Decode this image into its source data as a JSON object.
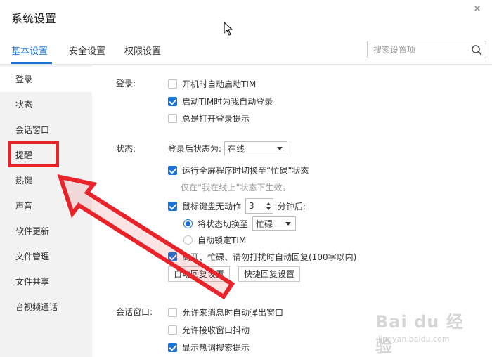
{
  "window": {
    "title": "系统设置",
    "close_glyph": "✕"
  },
  "tabs": [
    {
      "label": "基本设置",
      "active": true
    },
    {
      "label": "安全设置",
      "active": false
    },
    {
      "label": "权限设置",
      "active": false
    }
  ],
  "search": {
    "placeholder": "搜索设置项",
    "value": ""
  },
  "sidebar": {
    "items": [
      {
        "label": "登录"
      },
      {
        "label": "状态"
      },
      {
        "label": "会话窗口"
      },
      {
        "label": "提醒"
      },
      {
        "label": "热键"
      },
      {
        "label": "声音"
      },
      {
        "label": "软件更新"
      },
      {
        "label": "文件管理"
      },
      {
        "label": "文件共享"
      },
      {
        "label": "音视频通话"
      }
    ]
  },
  "login": {
    "section_label": "登录:",
    "options": [
      {
        "label": "开机时自动启动TIM",
        "checked": false
      },
      {
        "label": "启动TIM时为我自动登录",
        "checked": true
      },
      {
        "label": "总是打开登录提示",
        "checked": false
      }
    ]
  },
  "status": {
    "section_label": "状态:",
    "after_login_label": "登录后状态为:",
    "after_login_value": "在线",
    "fullscreen_label": "运行全屏程序时切换至“忙碌”状态",
    "fullscreen_checked": true,
    "fullscreen_hint": "仅在“我在线上”状态下生效。",
    "idle_label": "鼠标键盘无动作",
    "idle_checked": true,
    "idle_minutes": "3",
    "idle_suffix": "分钟后:",
    "switch_label": "将状态切换至",
    "switch_value": "忙碌",
    "switch_selected": true,
    "lock_label": "自动锁定TIM",
    "lock_selected": false,
    "auto_reply_label": "离开、忙碌、请勿打扰时自动回复(100字以内)",
    "auto_reply_checked": true,
    "auto_reply_btn": "自动回复设置",
    "quick_reply_btn": "快捷回复设置"
  },
  "session": {
    "section_label": "会话窗口:",
    "options": [
      {
        "label": "允许来消息时自动弹出窗口",
        "checked": false
      },
      {
        "label": "允许接收窗口抖动",
        "checked": false
      },
      {
        "label": "显示热词搜索提示",
        "checked": true
      }
    ]
  },
  "watermark": {
    "main": "Bai du 经验",
    "sub": "jingyan.baidu.com"
  },
  "colors": {
    "accent": "#1a74d8",
    "annotation": "#e8232a",
    "sidebar_bg": "#f2f2f2"
  },
  "icons": {
    "search": "search-icon",
    "close": "close-icon",
    "cursor": "cursor-arrow-icon",
    "annotation": "red-arrow-icon"
  }
}
